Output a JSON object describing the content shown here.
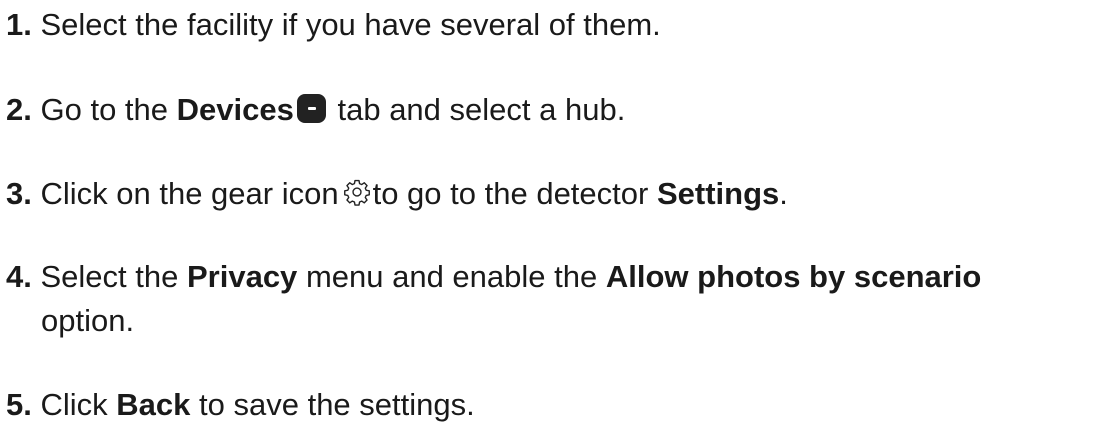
{
  "steps": [
    {
      "num": "1.",
      "text": "Select the facility if you have several of them."
    },
    {
      "num": "2.",
      "pre": "Go to the",
      "bold1": "Devices",
      "icon": "device-tab-icon",
      "post": "tab and select a hub."
    },
    {
      "num": "3.",
      "pre": "Click on the gear icon",
      "icon": "gear-icon",
      "mid": "to go to the detector",
      "bold1": "Settings",
      "post": "."
    },
    {
      "num": "4.",
      "pre": "Select the",
      "bold1": "Privacy",
      "mid": "menu and enable the",
      "bold2": "Allow photos by scenario",
      "post": "option."
    },
    {
      "num": "5.",
      "pre": "Click",
      "bold1": "Back",
      "post": "to save the settings."
    }
  ],
  "colors": {
    "text": "#1a1a1a",
    "icon_fill": "#222222",
    "background": "#ffffff"
  }
}
